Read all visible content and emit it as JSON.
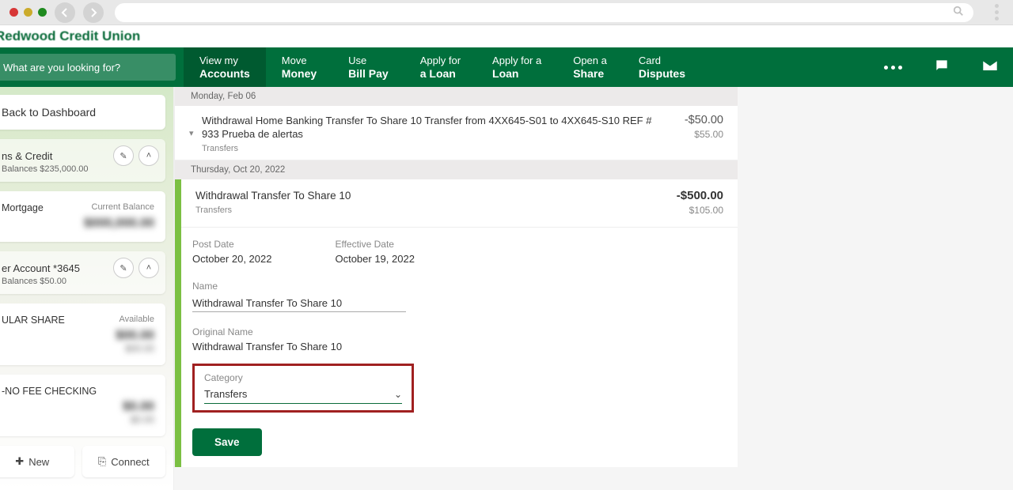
{
  "bank_name": "Redwood Credit Union",
  "search_placeholder": "What are you looking for?",
  "nav": [
    {
      "l1": "View my",
      "l2": "Accounts"
    },
    {
      "l1": "Move",
      "l2": "Money"
    },
    {
      "l1": "Use",
      "l2": "Bill Pay"
    },
    {
      "l1": "Apply for",
      "l2": "a Loan"
    },
    {
      "l1": "Apply for a",
      "l2": "Loan"
    },
    {
      "l1": "Open a",
      "l2": "Share"
    },
    {
      "l1": "Card",
      "l2": "Disputes"
    }
  ],
  "sidebar": {
    "back": "Back to Dashboard",
    "group1_title": "ns & Credit",
    "group1_sub": "Balances $235,000.00",
    "group1_item": "Mortgage",
    "group1_item_lbl": "Current Balance",
    "group2_title": "er Account *3645",
    "group2_sub": "Balances $50.00",
    "group2_item1": "ULAR SHARE",
    "group2_item1_lbl": "Available",
    "group2_item2": "-NO FEE CHECKING",
    "new_btn": "New",
    "connect_btn": "Connect"
  },
  "dates": {
    "d1": "Monday, Feb 06",
    "d2": "Thursday, Oct 20, 2022"
  },
  "txn1": {
    "desc": "Withdrawal Home Banking Transfer To Share 10 Transfer from 4XX645-S01 to 4XX645-S10 REF # 933 Prueba de alertas",
    "cat": "Transfers",
    "amt": "-$50.00",
    "bal": "$55.00"
  },
  "txn2": {
    "desc": "Withdrawal Transfer To Share 10",
    "cat": "Transfers",
    "amt": "-$500.00",
    "bal": "$105.00",
    "post_lbl": "Post Date",
    "post_val": "October 20, 2022",
    "eff_lbl": "Effective Date",
    "eff_val": "October 19, 2022",
    "name_lbl": "Name",
    "name_val": "Withdrawal Transfer To Share 10",
    "orig_lbl": "Original Name",
    "orig_val": "Withdrawal Transfer To Share 10",
    "cat_lbl": "Category",
    "cat_val": "Transfers",
    "save": "Save"
  }
}
